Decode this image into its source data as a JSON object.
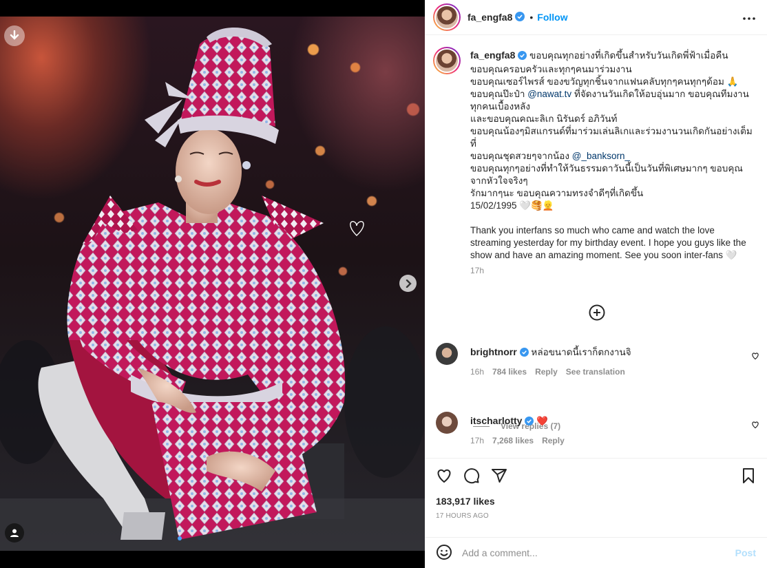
{
  "header": {
    "username": "fa_engfa8",
    "separator": "•",
    "follow_label": "Follow"
  },
  "caption": {
    "username": "fa_engfa8",
    "lines": [
      "ขอบคุณทุกอย่างที่เกิดขึ้นสำหรับวันเกิดพี่ฟ้าเมื่อคืน",
      "ขอบคุณครอบครัวและทุกๆคนมาร่วมงาน",
      "ขอบคุณเซอร์ไพรส์ ของขวัญทุกชิ้นจากแฟนคลับทุกๆคนทุกๆด้อม 🙏",
      "ขอบคุณป๊ะป๋า",
      "ที่จัดงานวันเกิดให้อบอุ่นมาก ขอบคุณทีมงาน",
      "ทุกคนเบื้องหลัง",
      "และขอบคุณคณะลิเก นิรันดร์ อภิวันท์",
      "ขอบคุณน้องๆมิสแกรนด์ที่มาร่วมเล่นลิเกและร่วมงานวนเกิดกันอย่างเต็ม",
      "ที่",
      "ขอบคุณชุดสวยๆจากน้อง",
      "ขอบคุณทุกๆอย่างที่ทำให้วันธรรมดาวันนี้เป็นวันที่พิเศษมากๆ ขอบคุณ",
      "จากหัวใจจริงๆ",
      "รักมากๆนะ ขอบคุณความทรงจำดีๆที่เกิดขึ้น",
      "15/02/1995 🤍🥞👱"
    ],
    "mention_1": "@nawat.tv",
    "mention_2": "@_banksorn_",
    "english": "Thank you interfans so much who came and watch the love streaming yesterday for my birthday event. I hope you guys like the show and have an amazing moment. See you soon inter-fans 🤍",
    "time": "17h"
  },
  "comments": [
    {
      "username": "brightnorr",
      "text": "หล่อขนาดนี้เราก็ตกงานจิ",
      "time": "16h",
      "likes": "784 likes",
      "reply": "Reply",
      "translate": "See translation",
      "view_replies": "View replies (7)"
    },
    {
      "username": "itscharlotty",
      "text": "❤️",
      "time": "17h",
      "likes": "7,268 likes",
      "reply": "Reply"
    }
  ],
  "post": {
    "likes": "183,917 likes",
    "ago": "17 HOURS AGO"
  },
  "composer": {
    "placeholder": "Add a comment...",
    "post_label": "Post"
  },
  "colors": {
    "accent": "#0095f6",
    "verified": "#3897f0",
    "heart": "#ed4956"
  }
}
